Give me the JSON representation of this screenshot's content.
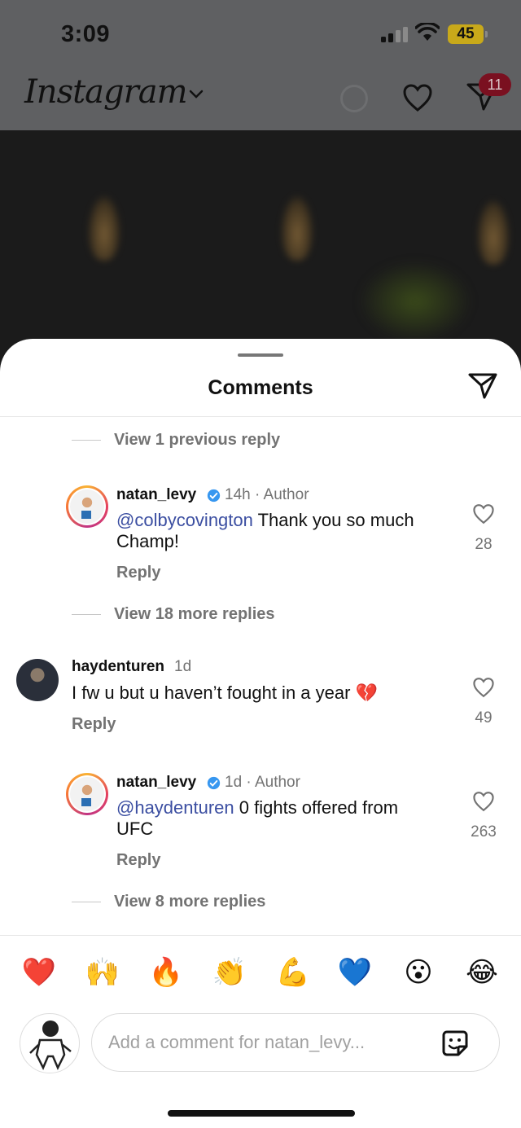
{
  "status_bar": {
    "time": "3:09",
    "battery": "45"
  },
  "header": {
    "logo": "Instagram",
    "dm_badge": "11"
  },
  "sheet": {
    "title": "Comments",
    "view_previous": "View 1 previous reply"
  },
  "comments": [
    {
      "username": "natan_levy",
      "verified": true,
      "meta": "14h · Author",
      "mention": "@colbycovington",
      "text_line1": " Thank you so much",
      "text_line2": "Champ!",
      "reply": "Reply",
      "likes": "28",
      "view_more": "View 18 more replies"
    },
    {
      "username": "haydenturen",
      "meta": "1d",
      "text": "I fw u but u haven’t fought in a year 💔",
      "reply": "Reply",
      "likes": "49"
    },
    {
      "username": "natan_levy",
      "verified": true,
      "meta": "1d · Author",
      "mention": "@haydenturen",
      "text_line1": " 0 fights offered from",
      "text_line2": "UFC",
      "reply": "Reply",
      "likes": "263",
      "view_more": "View 8 more replies"
    }
  ],
  "emoji_bar": [
    "❤️",
    "🙌",
    "🔥",
    "👏",
    "💪",
    "💙",
    "😮",
    "😂"
  ],
  "composer": {
    "placeholder": "Add a comment for natan_levy..."
  },
  "icons": {
    "heart": "heart-icon",
    "direct": "paper-plane-icon",
    "sticker": "sticker-icon",
    "verified": "verified-badge-icon"
  },
  "colors": {
    "mention": "#3b4ea1",
    "verified": "#3797f0",
    "badge": "#7a1020"
  }
}
